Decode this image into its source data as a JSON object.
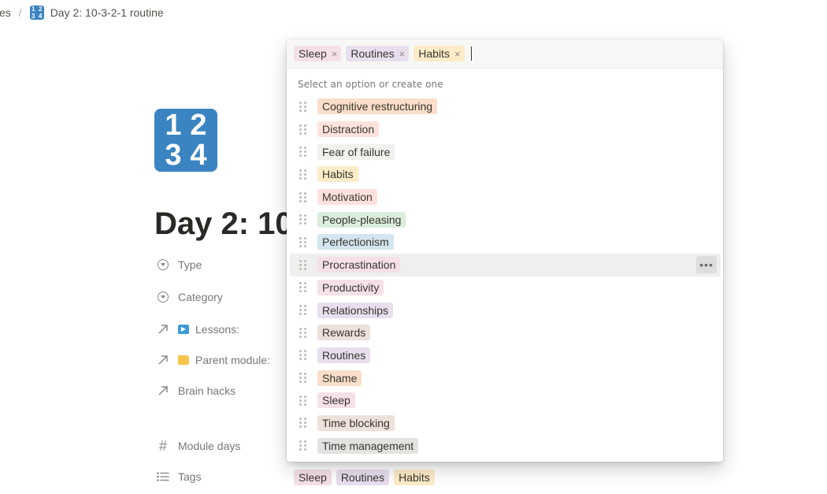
{
  "breadcrumb": {
    "prev": "es",
    "separator": "/",
    "current": "Day 2: 10-3-2-1 routine",
    "icon_digits": [
      "1",
      "2",
      "3",
      "4"
    ]
  },
  "page": {
    "icon_digits": [
      "1",
      "2",
      "3",
      "4"
    ],
    "icon_color": "#3a84c2",
    "title": "Day 2: 10"
  },
  "properties": [
    {
      "name": "Type",
      "icon": "select-icon"
    },
    {
      "name": "Category",
      "icon": "select-icon"
    },
    {
      "name": "Lessons:",
      "icon": "relation-arrow-icon",
      "emoji": "play-button-emoji"
    },
    {
      "name": "Parent module:",
      "icon": "relation-arrow-icon",
      "emoji": "folder-emoji"
    },
    {
      "name": "Brain hacks",
      "icon": "relation-arrow-icon"
    },
    {
      "name": "Module days",
      "icon": "hash-icon"
    },
    {
      "name": "Tags",
      "icon": "list-icon"
    }
  ],
  "tags_value": [
    {
      "label": "Sleep",
      "color": "pink"
    },
    {
      "label": "Routines",
      "color": "purple"
    },
    {
      "label": "Habits",
      "color": "yellow"
    }
  ],
  "popup": {
    "selected": [
      {
        "label": "Sleep",
        "color": "pink"
      },
      {
        "label": "Routines",
        "color": "purple"
      },
      {
        "label": "Habits",
        "color": "yellow"
      }
    ],
    "remove_symbol": "×",
    "hint": "Select an option or create one",
    "options": [
      {
        "label": "Cognitive restructuring",
        "color": "orange"
      },
      {
        "label": "Distraction",
        "color": "red"
      },
      {
        "label": "Fear of failure",
        "color": "default"
      },
      {
        "label": "Habits",
        "color": "yellow"
      },
      {
        "label": "Motivation",
        "color": "red"
      },
      {
        "label": "People-pleasing",
        "color": "green"
      },
      {
        "label": "Perfectionism",
        "color": "blue"
      },
      {
        "label": "Procrastination",
        "color": "pink",
        "hovered": true
      },
      {
        "label": "Productivity",
        "color": "pink"
      },
      {
        "label": "Relationships",
        "color": "purple"
      },
      {
        "label": "Rewards",
        "color": "brown"
      },
      {
        "label": "Routines",
        "color": "purple"
      },
      {
        "label": "Shame",
        "color": "orange"
      },
      {
        "label": "Sleep",
        "color": "pink"
      },
      {
        "label": "Time blocking",
        "color": "brown"
      },
      {
        "label": "Time management",
        "color": "gray"
      }
    ],
    "more_symbol": "•••"
  }
}
